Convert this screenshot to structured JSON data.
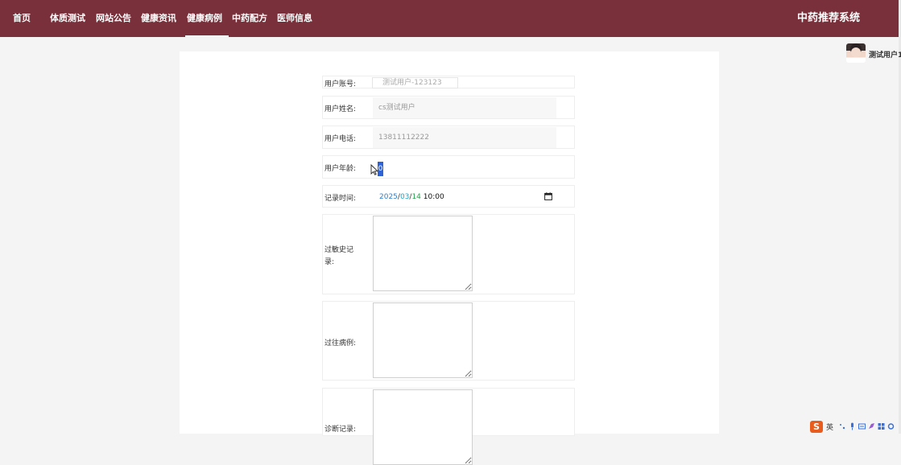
{
  "nav": {
    "items": [
      {
        "label": "首页"
      },
      {
        "label": "体质测试"
      },
      {
        "label": "网站公告"
      },
      {
        "label": "健康资讯"
      },
      {
        "label": "健康病例"
      },
      {
        "label": "中药配方"
      },
      {
        "label": "医师信息"
      }
    ],
    "active_index": 4,
    "brand": "中药推荐系统"
  },
  "user": {
    "name": "测试用户1"
  },
  "form": {
    "account": {
      "label": "用户账号:",
      "value": "测试用户-123123"
    },
    "name": {
      "label": "用户姓名:",
      "value": "cs测试用户"
    },
    "phone": {
      "label": "用户电话:",
      "value": "13811112222"
    },
    "age": {
      "label": "用户年龄:",
      "value": "0"
    },
    "record_time": {
      "label": "记录时间:",
      "year": "2025",
      "sep1": "/",
      "month": "03",
      "sep2": "/",
      "day": "14",
      "time": " 10:00"
    },
    "allergy": {
      "label_line1": "过敏史记",
      "label_line2": "录:",
      "value": ""
    },
    "history": {
      "label": "过往病例:",
      "value": ""
    },
    "diagnosis": {
      "label": "诊断记录:",
      "value": ""
    }
  },
  "ime": {
    "mode_label": "英"
  },
  "colors": {
    "header_bg": "#79303a",
    "page_bg": "#f4f4f4",
    "selection": "#2f63d5",
    "date_year": "#2a7fd0",
    "date_month": "#19a7c9",
    "date_day": "#23a34a"
  }
}
